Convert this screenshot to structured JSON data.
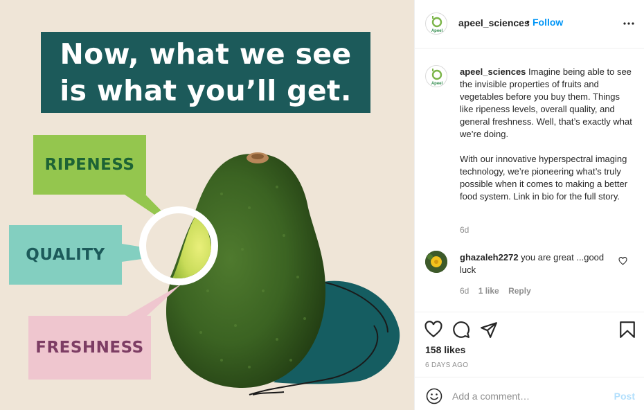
{
  "post_image": {
    "headline_line1": "Now, what we see",
    "headline_line2": "is what you’ll get.",
    "tags": {
      "ripeness": "RIPENESS",
      "quality": "QUALITY",
      "freshness": "FRESHNESS"
    },
    "colors": {
      "background": "#efe5d7",
      "headline_bg": "#1c5a5a",
      "ripeness_bg": "#94c64e",
      "quality_bg": "#83cfc0",
      "freshness_bg": "#efc6cf",
      "shadow": "#155d61"
    }
  },
  "header": {
    "username": "apeel_sciences",
    "separator": "•",
    "follow_label": "Follow",
    "avatar_icon": "apeel-logo-icon",
    "more_icon": "more-options-icon"
  },
  "caption": {
    "username": "apeel_sciences",
    "paragraph1": "Imagine being able to see the invisible properties of fruits and vegetables before you buy them. Things like ripeness levels, overall quality, and general freshness. Well, that’s exactly what we’re doing.",
    "paragraph2": "With our innovative hyperspectral imaging technology, we’re pioneering what’s truly possible when it comes to making a better food system. Link in bio for the full story.",
    "time": "6d"
  },
  "comment": {
    "username": "ghazaleh2272",
    "text": "you are great ...good luck",
    "time": "6d",
    "likes": "1 like",
    "reply_label": "Reply"
  },
  "actions": {
    "like_icon": "heart-icon",
    "comment_icon": "comment-icon",
    "share_icon": "share-icon",
    "save_icon": "bookmark-icon"
  },
  "stats": {
    "likes": "158 likes",
    "date": "6 DAYS AGO"
  },
  "comment_box": {
    "placeholder": "Add a comment…",
    "post_label": "Post"
  },
  "accent_color": "#0095f6"
}
